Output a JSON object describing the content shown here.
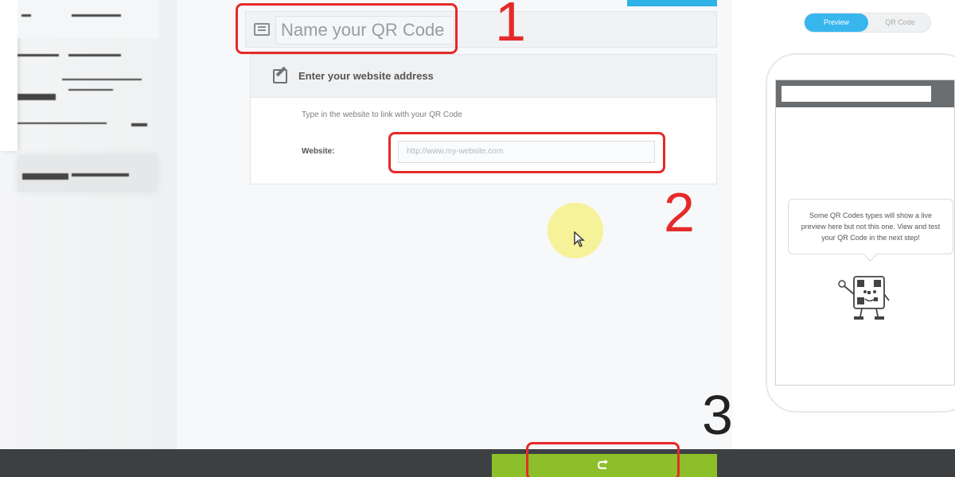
{
  "form": {
    "name_placeholder": "Name your QR Code",
    "website_section_title": "Enter your website address",
    "website_hint": "Type in the website to link with your QR Code",
    "website_label": "Website:",
    "website_placeholder": "http://www.my-website.com"
  },
  "preview": {
    "toggle_preview": "Preview",
    "toggle_qr": "QR Code",
    "message": "Some QR Codes types will show a live preview here but not this one. View and test your QR Code in the next step!"
  },
  "annotations": {
    "step1": "1",
    "step2": "2",
    "step3": "3"
  },
  "colors": {
    "accent_blue": "#37b6ee",
    "next_green": "#8dbf2b",
    "annotation_red": "#e52a2a"
  }
}
